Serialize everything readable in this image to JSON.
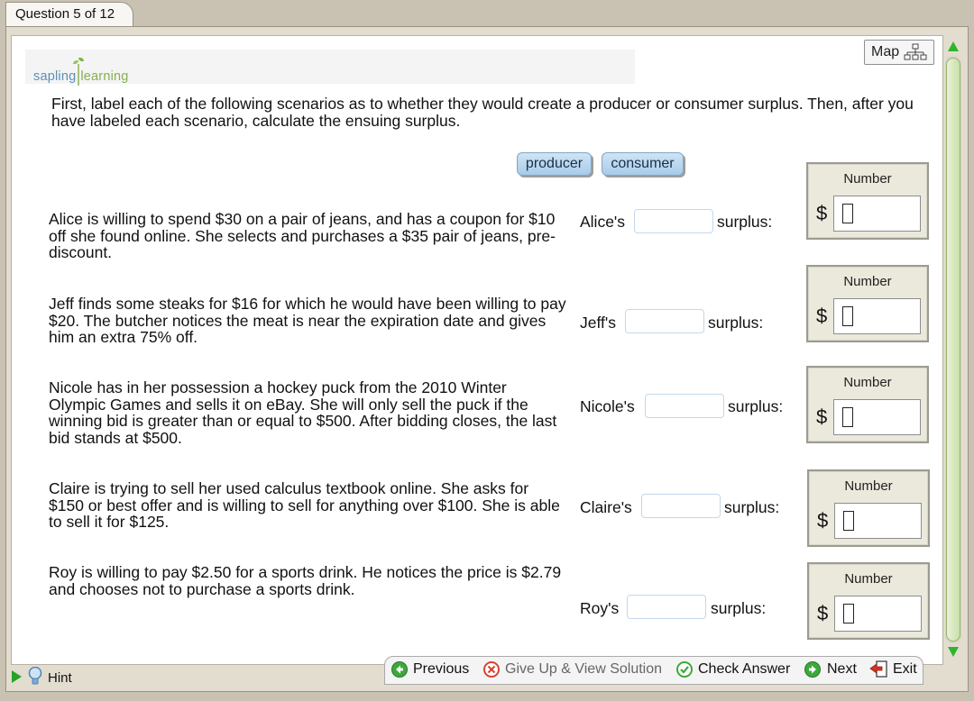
{
  "header": {
    "question_tab": "Question 5 of 12"
  },
  "logo": {
    "part1": "sapling",
    "part2": "learning"
  },
  "map_button": {
    "label": "Map"
  },
  "instructions": "First, label each of the following scenarios as to whether they would create a producer or consumer surplus. Then, after you have labeled each scenario, calculate the ensuing surplus.",
  "labels": [
    "producer",
    "consumer"
  ],
  "number_label": "Number",
  "currency": "$",
  "surplus_word": "surplus:",
  "scenarios": [
    {
      "text": "Alice is willing to spend $30 on a pair of jeans, and has a coupon for $10 off she found online. She selects and purchases a $35 pair of jeans, pre-discount.",
      "owner": "Alice's",
      "dropped": "",
      "number": ""
    },
    {
      "text": "Jeff finds some steaks for $16 for which he would have been willing to pay $20. The butcher notices the meat is near the expiration date and gives him an extra 75% off.",
      "owner": "Jeff's",
      "dropped": "",
      "number": ""
    },
    {
      "text": "Nicole has in her possession a hockey puck from the 2010 Winter Olympic Games and sells it on eBay. She will only sell the puck if the winning bid is greater than or equal to $500. After bidding closes, the last bid stands at $500.",
      "owner": "Nicole's",
      "dropped": "",
      "number": ""
    },
    {
      "text": "Claire is trying to sell her used calculus textbook online. She asks for $150 or best offer and is willing to sell for anything over $100. She is able to sell it for $125.",
      "owner": "Claire's",
      "dropped": "",
      "number": ""
    },
    {
      "text": "Roy is willing to pay $2.50 for a sports drink. He notices the price is $2.79 and chooses not to purchase a sports drink.",
      "owner": "Roy's",
      "dropped": "",
      "number": ""
    }
  ],
  "footer": {
    "hint": "Hint",
    "previous": "Previous",
    "give_up": "Give Up & View Solution",
    "check_answer": "Check Answer",
    "next": "Next",
    "exit": "Exit"
  }
}
